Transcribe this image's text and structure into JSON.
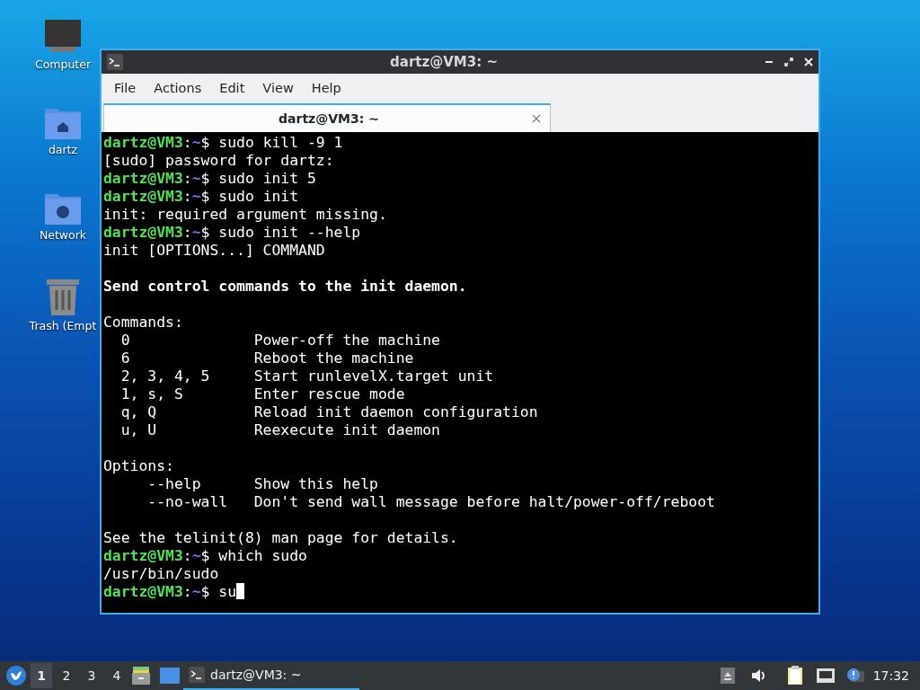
{
  "desktop_icons": [
    {
      "kind": "computer",
      "label": "Computer"
    },
    {
      "kind": "home",
      "label": "dartz"
    },
    {
      "kind": "network",
      "label": "Network"
    },
    {
      "kind": "trash",
      "label": "Trash (Empt"
    }
  ],
  "window": {
    "title": "dartz@VM3: ~",
    "menu": [
      "File",
      "Actions",
      "Edit",
      "View",
      "Help"
    ],
    "tabs": [
      {
        "label": "dartz@VM3: ~",
        "selected": true
      }
    ],
    "terminal": [
      {
        "kind": "prompt",
        "user": "dartz@VM3",
        "sep": ":",
        "path": "~",
        "command": "$ sudo kill -9 1"
      },
      {
        "kind": "output",
        "text": "[sudo] password for dartz:"
      },
      {
        "kind": "prompt",
        "user": "dartz@VM3",
        "sep": ":",
        "path": "~",
        "command": "$ sudo init 5"
      },
      {
        "kind": "prompt",
        "user": "dartz@VM3",
        "sep": ":",
        "path": "~",
        "command": "$ sudo init"
      },
      {
        "kind": "output",
        "text": "init: required argument missing."
      },
      {
        "kind": "prompt",
        "user": "dartz@VM3",
        "sep": ":",
        "path": "~",
        "command": "$ sudo init --help"
      },
      {
        "kind": "output",
        "text": "init [OPTIONS...] COMMAND"
      },
      {
        "kind": "blank"
      },
      {
        "kind": "bold",
        "text": "Send control commands to the init daemon."
      },
      {
        "kind": "blank"
      },
      {
        "kind": "output",
        "text": "Commands:"
      },
      {
        "kind": "output",
        "text": "  0              Power-off the machine"
      },
      {
        "kind": "output",
        "text": "  6              Reboot the machine"
      },
      {
        "kind": "output",
        "text": "  2, 3, 4, 5     Start runlevelX.target unit"
      },
      {
        "kind": "output",
        "text": "  1, s, S        Enter rescue mode"
      },
      {
        "kind": "output",
        "text": "  q, Q           Reload init daemon configuration"
      },
      {
        "kind": "output",
        "text": "  u, U           Reexecute init daemon"
      },
      {
        "kind": "blank"
      },
      {
        "kind": "output",
        "text": "Options:"
      },
      {
        "kind": "output",
        "text": "     --help      Show this help"
      },
      {
        "kind": "output",
        "text": "     --no-wall   Don't send wall message before halt/power-off/reboot"
      },
      {
        "kind": "blank"
      },
      {
        "kind": "output",
        "text": "See the telinit(8) man page for details."
      },
      {
        "kind": "prompt",
        "user": "dartz@VM3",
        "sep": ":",
        "path": "~",
        "command": "$ which sudo"
      },
      {
        "kind": "output",
        "text": "/usr/bin/sudo"
      },
      {
        "kind": "prompt",
        "user": "dartz@VM3",
        "sep": ":",
        "path": "~",
        "command": "$ su",
        "cursor": true
      }
    ]
  },
  "taskbar": {
    "workspaces": [
      {
        "label": "1",
        "selected": true
      },
      {
        "label": "2",
        "selected": false
      },
      {
        "label": "3",
        "selected": false
      },
      {
        "label": "4",
        "selected": false
      }
    ],
    "tasks": [
      {
        "label": "dartz@VM3: ~",
        "selected": true
      }
    ],
    "clock": "17:32"
  }
}
